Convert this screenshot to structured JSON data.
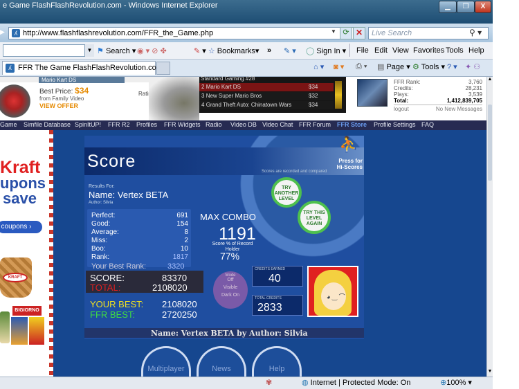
{
  "window": {
    "title": "e Game FlashFlashRevolution.com - Windows Internet Explorer",
    "btn_min": "▁",
    "btn_max": "❐",
    "btn_close": "X"
  },
  "address": {
    "url": "http://www.flashflashrevolution.com/FFR_the_Game.php",
    "search_placeholder": "Live Search"
  },
  "commandbar": {
    "search": "Search",
    "bookmarks": "Bookmarks",
    "more": "»",
    "sign_in": "Sign In",
    "menu_file": "File",
    "menu_edit": "Edit",
    "menu_view": "View",
    "menu_favorites": "Favorites",
    "menu_tools": "Tools",
    "menu_help": "Help"
  },
  "tabs": {
    "active_label": "FFR The Game FlashFlashRevolution.com",
    "page": "Page",
    "tools": "Tools"
  },
  "ad": {
    "product_title": "Mario Kart DS",
    "best_price_label": "Best Price:",
    "best_price": "$34",
    "source": "from Family Video",
    "view_offer": "VIEW OFFER",
    "rating": "Rating",
    "header": "Standard Gaming #28",
    "list": [
      {
        "rank": "2",
        "name": "Mario Kart DS",
        "price": "$34"
      },
      {
        "rank": "3",
        "name": "New Super Mario Bros",
        "price": "$32"
      },
      {
        "rank": "4",
        "name": "Grand Theft Auto: Chinatown Wars",
        "price": "$34"
      }
    ]
  },
  "user_stats": {
    "rank_label": "FFR Rank:",
    "rank": "3,760",
    "credits_label": "Credits:",
    "credits": "28,231",
    "plays_label": "Plays:",
    "plays": "3,539",
    "total_label": "Total:",
    "total": "1,412,839,705",
    "logout": "logout",
    "messages": "No New Messages"
  },
  "nav": [
    "Game",
    "Simfile Database",
    "SpinItUP!",
    "FFR R2",
    "Profiles",
    "FFR Widgets",
    "Radio",
    "Video DB",
    "Video Chat",
    "FFR Forum",
    "FFR Store",
    "Profile Settings",
    "FAQ"
  ],
  "side_ad": {
    "line1": "Kraft",
    "line2": "upons",
    "line3": "save",
    "button": "t coupons ›",
    "brand": "KRAFT",
    "product": "BIGIORNO"
  },
  "game": {
    "heading": "Score",
    "press_for": "Press for",
    "hiscores": "Hi-Scores",
    "recorded_note": "Scores are recorded and compared",
    "results_for": "Results For:",
    "song_name": "Name: Vertex BETA",
    "author": "Author: Silvia",
    "try_another": "TRY ANOTHER LEVEL",
    "try_again": "TRY THIS LEVEL AGAIN",
    "stats": [
      {
        "label": "Perfect:",
        "value": "691"
      },
      {
        "label": "Good:",
        "value": "154"
      },
      {
        "label": "Average:",
        "value": "8"
      },
      {
        "label": "Miss:",
        "value": "2"
      },
      {
        "label": "Boo:",
        "value": "10"
      },
      {
        "label": "Rank:",
        "value": "1817"
      }
    ],
    "best_rank_label": "Your Best Rank:",
    "best_rank": "3320",
    "max_combo_label": "MAX COMBO",
    "max_combo": "1191",
    "percent_label": "Score % of Record Holder",
    "percent": "77%",
    "score_label": "SCORE:",
    "score": "83370",
    "total_label": "TOTAL:",
    "total": "2108020",
    "your_best_label": "YOUR BEST:",
    "your_best": "2108020",
    "ffr_best_label": "FFR BEST:",
    "ffr_best": "2720250",
    "mode_title": "Mode",
    "mode_off": "Off",
    "mode_visible": "Visible",
    "mode_dark": "Dark On",
    "credits_earned_label": "CREDITS EARNED",
    "credits_earned": "40",
    "total_credits_label": "TOTAL CREDITS",
    "total_credits": "2833",
    "footer": "Name: Vertex BETA by Author: Silvia",
    "btn_multiplayer": "Multiplayer",
    "btn_news": "News",
    "btn_help": "Help"
  },
  "status": {
    "zone": "Internet | Protected Mode: On",
    "zoom": "100%"
  }
}
